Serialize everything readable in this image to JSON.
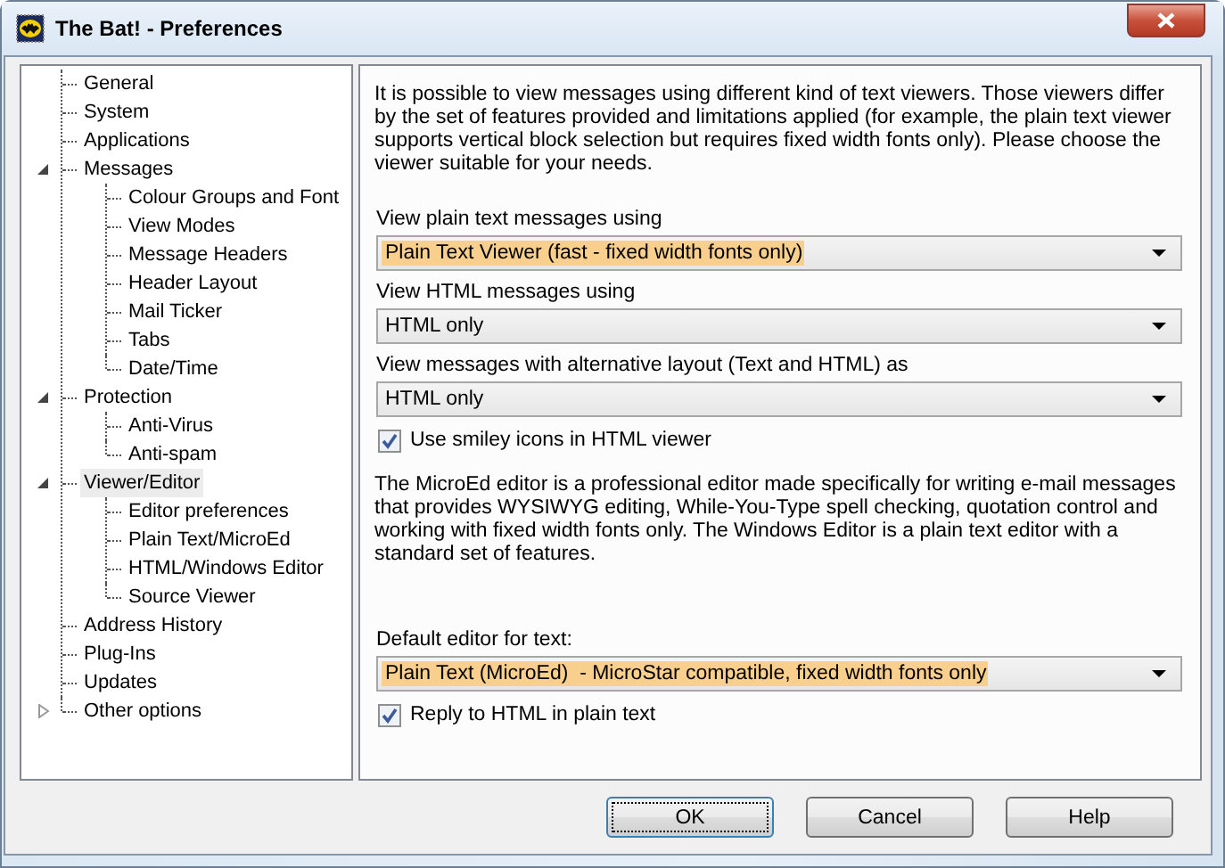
{
  "window": {
    "title": "The Bat! - Preferences"
  },
  "tree": [
    {
      "label": "General",
      "selected": false
    },
    {
      "label": "System",
      "selected": false
    },
    {
      "label": "Applications",
      "selected": false
    },
    {
      "label": "Messages",
      "selected": false,
      "expanded": true,
      "children": [
        {
          "label": "Colour Groups and Font",
          "selected": false
        },
        {
          "label": "View Modes",
          "selected": false
        },
        {
          "label": "Message Headers",
          "selected": false
        },
        {
          "label": "Header Layout",
          "selected": false
        },
        {
          "label": "Mail Ticker",
          "selected": false
        },
        {
          "label": "Tabs",
          "selected": false
        },
        {
          "label": "Date/Time",
          "selected": false
        }
      ]
    },
    {
      "label": "Protection",
      "selected": false,
      "expanded": true,
      "children": [
        {
          "label": "Anti-Virus",
          "selected": false
        },
        {
          "label": "Anti-spam",
          "selected": false
        }
      ]
    },
    {
      "label": "Viewer/Editor",
      "selected": true,
      "expanded": true,
      "children": [
        {
          "label": "Editor preferences",
          "selected": false
        },
        {
          "label": "Plain Text/MicroEd",
          "selected": false
        },
        {
          "label": "HTML/Windows Editor",
          "selected": false
        },
        {
          "label": "Source Viewer",
          "selected": false
        }
      ]
    },
    {
      "label": "Address History",
      "selected": false
    },
    {
      "label": "Plug-Ins",
      "selected": false
    },
    {
      "label": "Updates",
      "selected": false
    },
    {
      "label": "Other options",
      "selected": false,
      "expanded": false
    }
  ],
  "panel": {
    "items": [
      {
        "kind": "paragraph",
        "text": "It is possible to view messages using different kind of text viewers. Those viewers differ by the set of features provided and limitations applied (for example, the plain text viewer supports vertical block selection but requires fixed width fonts only). Please choose the viewer suitable for your needs."
      },
      {
        "kind": "dropdown",
        "label": "View plain text messages using",
        "value": "Plain Text Viewer (fast - fixed width fonts only)",
        "highlighted": true
      },
      {
        "kind": "dropdown",
        "label": "View HTML messages using",
        "value": "HTML only",
        "highlighted": false
      },
      {
        "kind": "dropdown",
        "label": "View messages with alternative layout (Text and HTML) as",
        "value": "HTML only",
        "highlighted": false
      },
      {
        "kind": "checkbox",
        "label": "Use smiley icons in HTML viewer",
        "checked": true
      },
      {
        "kind": "paragraph",
        "text": "The MicroEd editor is a professional editor made specifically for writing e-mail messages that provides WYSIWYG editing, While-You-Type spell checking, quotation control and working with fixed width fonts only. The Windows Editor is a plain text editor with a standard set of features."
      },
      {
        "kind": "dropdown",
        "label": "Default editor for text:",
        "value": "Plain Text (MicroEd)  - MicroStar compatible, fixed width fonts only",
        "highlighted": true
      },
      {
        "kind": "checkbox",
        "label": "Reply to HTML in plain text",
        "checked": true
      }
    ]
  },
  "buttons": [
    {
      "label": "OK",
      "focused": true
    },
    {
      "label": "Cancel",
      "focused": false
    },
    {
      "label": "Help",
      "focused": false
    }
  ]
}
